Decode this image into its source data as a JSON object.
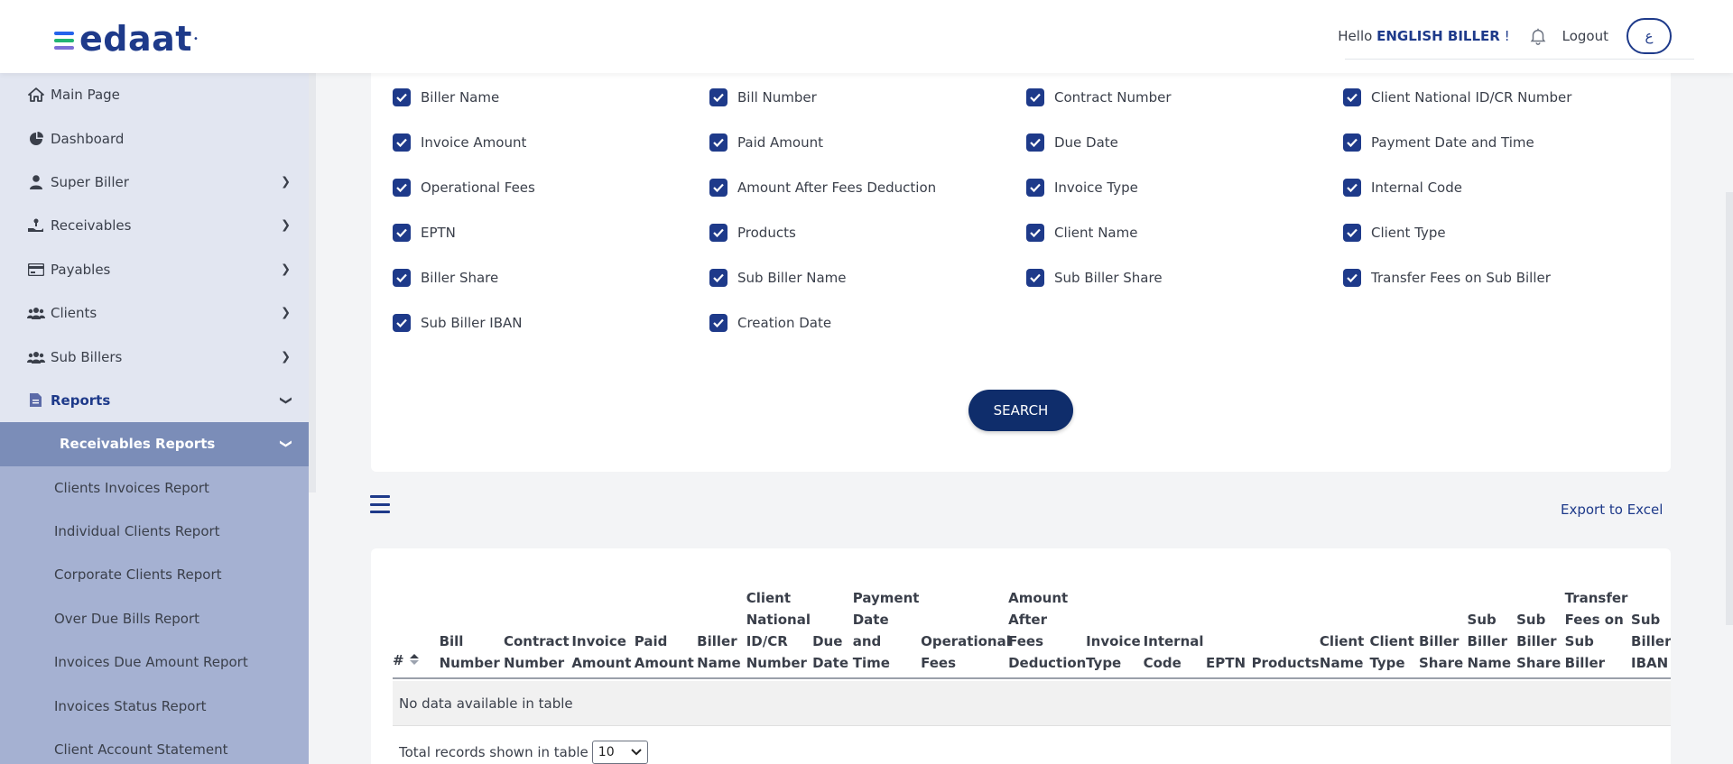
{
  "header": {
    "logo_text": "edaat",
    "logo_colors": [
      "#2563eb",
      "#22b573",
      "#7c6fd6"
    ],
    "hello_prefix": "Hello",
    "username": "ENGLISH BILLER",
    "hello_suffix": "!",
    "logout": "Logout",
    "lang_toggle": "ع"
  },
  "sidebar": {
    "items": [
      {
        "label": "Main Page",
        "icon": "home-icon"
      },
      {
        "label": "Dashboard",
        "icon": "pie-chart-icon"
      },
      {
        "label": "Super Biller",
        "icon": "user-icon"
      },
      {
        "label": "Receivables",
        "icon": "hand-money-icon"
      },
      {
        "label": "Payables",
        "icon": "card-icon"
      },
      {
        "label": "Clients",
        "icon": "users-icon"
      },
      {
        "label": "Sub Billers",
        "icon": "users-icon"
      },
      {
        "label": "Reports",
        "icon": "document-icon"
      }
    ],
    "active_sub": "Receivables Reports",
    "sub_items": [
      "Clients Invoices Report",
      "Individual Clients Report",
      "Corporate Clients Report",
      "Over Due Bills Report",
      "Invoices Due Amount Report",
      "Invoices Status Report",
      "Client Account Statement"
    ]
  },
  "filters": {
    "rows": [
      [
        "Biller Name",
        "Bill Number",
        "Contract Number",
        "Client National ID/CR Number"
      ],
      [
        "Invoice Amount",
        "Paid Amount",
        "Due Date",
        "Payment Date and Time"
      ],
      [
        "Operational Fees",
        "Amount After Fees Deduction",
        "Invoice Type",
        "Internal Code"
      ],
      [
        "EPTN",
        "Products",
        "Client Name",
        "Client Type"
      ],
      [
        "Biller Share",
        "Sub Biller Name",
        "Sub Biller Share",
        "Transfer Fees on Sub Biller"
      ],
      [
        "Sub Biller IBAN",
        "Creation Date"
      ]
    ],
    "search_label": "SEARCH"
  },
  "toolbar": {
    "export_label": "Export to Excel"
  },
  "table": {
    "columns": [
      "#",
      "Bill\nNumber",
      "Contract\nNumber",
      "Invoice\nAmount",
      "Paid\nAmount",
      "Biller\nName",
      "Client\nNational\nID/CR\nNumber",
      "Due\nDate",
      "Payment\nDate and\nTime",
      "Operational\nFees",
      "Amount\nAfter\nFees\nDeduction",
      "Invoice\nType",
      "Internal\nCode",
      "EPTN",
      "Products",
      "Client\nName",
      "Client\nType",
      "Biller\nShare",
      "Sub\nBiller\nName",
      "Sub\nBiller\nShare",
      "Transfer\nFees on\nSub\nBiller",
      "Sub\nBiller\nIBAN"
    ],
    "empty_message": "No data available in table",
    "page_size_label": "Total records shown in table",
    "page_size_value": "10"
  }
}
